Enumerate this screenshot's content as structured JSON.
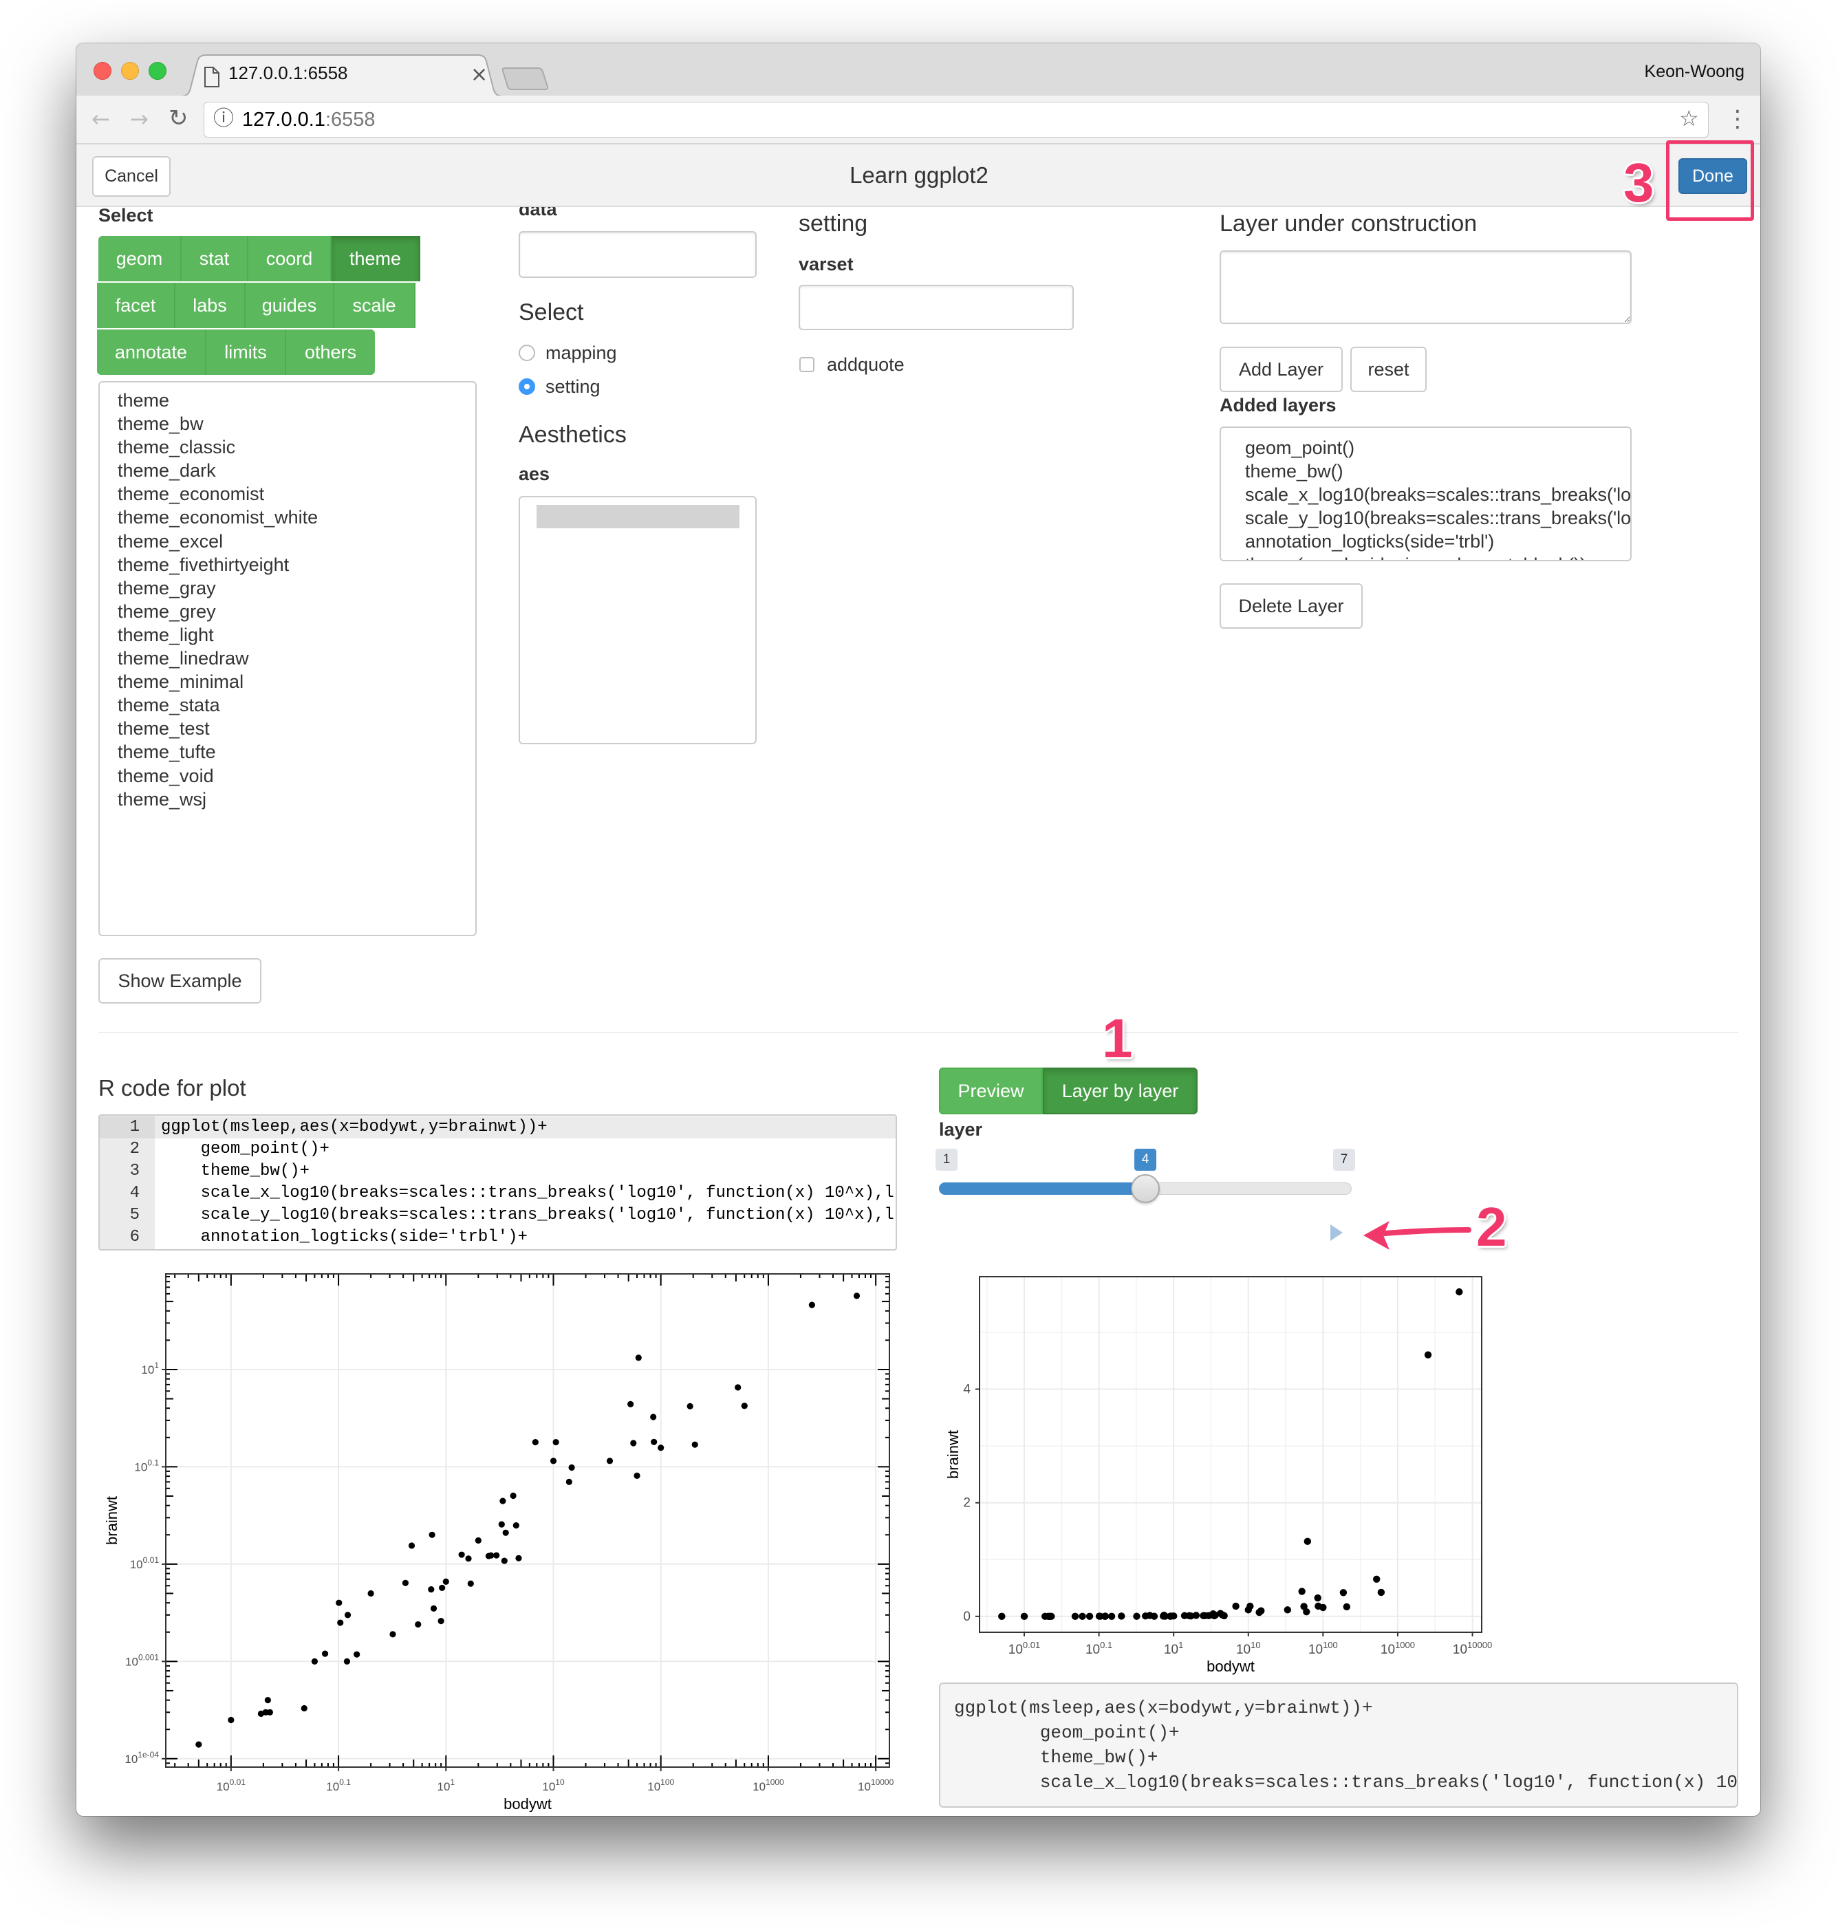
{
  "browser": {
    "tab_title": "127.0.0.1:6558",
    "profile_name": "Keon-Woong",
    "url_host": "127.0.0.1",
    "url_port": ":6558",
    "tab_close_glyph": "×"
  },
  "icons": {
    "back": "←",
    "forward": "→",
    "reload": "↻",
    "info": "ⓘ",
    "star": "☆",
    "menu": "⋮",
    "page": "file-icon",
    "play": "play-icon"
  },
  "header": {
    "cancel_label": "Cancel",
    "title": "Learn ggplot2",
    "done_label": "Done"
  },
  "left": {
    "select_label": "Select",
    "categories": [
      {
        "label": "geom",
        "active": false
      },
      {
        "label": "stat",
        "active": false
      },
      {
        "label": "coord",
        "active": false
      },
      {
        "label": "theme",
        "active": true
      },
      {
        "label": "facet",
        "active": false
      },
      {
        "label": "labs",
        "active": false
      },
      {
        "label": "guides",
        "active": false
      },
      {
        "label": "scale",
        "active": false
      },
      {
        "label": "annotate",
        "active": false
      },
      {
        "label": "limits",
        "active": false
      },
      {
        "label": "others",
        "active": false
      }
    ],
    "functions": [
      "theme",
      "theme_bw",
      "theme_classic",
      "theme_dark",
      "theme_economist",
      "theme_economist_white",
      "theme_excel",
      "theme_fivethirtyeight",
      "theme_gray",
      "theme_grey",
      "theme_light",
      "theme_linedraw",
      "theme_minimal",
      "theme_stata",
      "theme_test",
      "theme_tufte",
      "theme_void",
      "theme_wsj"
    ],
    "show_example_label": "Show Example"
  },
  "middle": {
    "data_label": "data",
    "data_value": "",
    "select_heading": "Select",
    "radios": [
      {
        "label": "mapping",
        "checked": false
      },
      {
        "label": "setting",
        "checked": true
      }
    ],
    "aesthetics_heading": "Aesthetics",
    "aes_label": "aes"
  },
  "setting": {
    "heading": "setting",
    "varset_label": "varset",
    "varset_value": "",
    "addquote_label": "addquote",
    "addquote_checked": false
  },
  "layer": {
    "heading": "Layer under construction",
    "textarea_value": "",
    "add_label": "Add Layer",
    "reset_label": "reset",
    "added_heading": "Added layers",
    "added": [
      "geom_point()",
      "theme_bw()",
      "scale_x_log10(breaks=scales::trans_breaks('lo",
      "scale_y_log10(breaks=scales::trans_breaks('lo",
      "annotation_logticks(side='trbl')",
      "theme(panel.grid.minor=element_blank())"
    ],
    "delete_label": "Delete Layer"
  },
  "rcode": {
    "heading": "R code for plot",
    "lines": [
      {
        "num": "1",
        "text": "ggplot(msleep,aes(x=bodywt,y=brainwt))+"
      },
      {
        "num": "2",
        "text": "    geom_point()+"
      },
      {
        "num": "3",
        "text": "    theme_bw()+"
      },
      {
        "num": "4",
        "text": "    scale_x_log10(breaks=scales::trans_breaks('log10', function(x) 10^x),l"
      },
      {
        "num": "5",
        "text": "    scale_y_log10(breaks=scales::trans_breaks('log10', function(x) 10^x),l"
      },
      {
        "num": "6",
        "text": "    annotation_logticks(side='trbl')+"
      }
    ]
  },
  "viewer": {
    "modes": [
      {
        "label": "Preview",
        "active": false
      },
      {
        "label": "Layer by layer",
        "active": true
      }
    ],
    "layer_label": "layer",
    "slider": {
      "min": 1,
      "max": 7,
      "value": 4,
      "min_label": "1",
      "max_label": "7",
      "value_label": "4"
    },
    "code_lines": [
      "ggplot(msleep,aes(x=bodywt,y=brainwt))+",
      "        geom_point()+",
      "        theme_bw()+",
      "        scale_x_log10(breaks=scales::trans_breaks('log10', function(x) 10"
    ]
  },
  "annotations": {
    "one": "1",
    "two": "2",
    "three": "3"
  },
  "colors": {
    "accent_green": "#5cb85c",
    "active_green": "#449d44",
    "primary_blue": "#337ab7",
    "slider_blue": "#428bca",
    "annotation_pink": "#f0386b"
  },
  "chart_data": [
    {
      "id": "left-plot",
      "type": "scatter",
      "title": "",
      "xlabel": "bodywt",
      "ylabel": "brainwt",
      "x_scale": "log10",
      "y_scale": "log10",
      "x_breaks": [
        0.01,
        0.1,
        1,
        10,
        100,
        1000,
        10000
      ],
      "x_tick_labels": [
        {
          "base": "10",
          "exp": "0.01"
        },
        {
          "base": "10",
          "exp": "0.1"
        },
        {
          "base": "10",
          "exp": "1"
        },
        {
          "base": "10",
          "exp": "10"
        },
        {
          "base": "10",
          "exp": "100"
        },
        {
          "base": "10",
          "exp": "1000"
        },
        {
          "base": "10",
          "exp": "10000"
        }
      ],
      "y_breaks": [
        0.0001,
        0.001,
        0.01,
        0.1,
        1
      ],
      "y_tick_labels": [
        {
          "base": "10",
          "exp": "1e-04"
        },
        {
          "base": "10",
          "exp": "0.001"
        },
        {
          "base": "10",
          "exp": "0.01"
        },
        {
          "base": "10",
          "exp": "0.1"
        },
        {
          "base": "10",
          "exp": "1"
        }
      ],
      "xlim": [
        0.00247,
        13400
      ],
      "ylim": [
        8.2e-05,
        9.6
      ],
      "grid": "major",
      "minor_grid": false,
      "logticks": "trbl",
      "x": [
        0.48,
        0.019,
        600,
        14,
        14.8,
        33.5,
        0.728,
        4.75,
        0.42,
        0.06,
        1,
        0.005,
        3.5,
        2.95,
        1.7,
        2547,
        0.023,
        521,
        187,
        0.77,
        10,
        3.3,
        0.2,
        85,
        2.625,
        62,
        6654,
        6.8,
        0.12,
        0.022,
        0.01,
        1.4,
        2.5,
        55.5,
        52.2,
        100,
        10.55,
        0.55,
        0.021,
        1.62,
        60,
        3.6,
        0.32,
        0.743,
        0.075,
        0.148,
        0.122,
        0.92,
        0.101,
        0.048,
        86.25,
        4.5,
        207.501,
        0.9,
        0.104,
        2,
        3.38,
        4.23
      ],
      "y": [
        0.0155,
        0.00029,
        0.423,
        0.07,
        0.0982,
        0.115,
        0.0055,
        0.0115,
        0.0064,
        0.001,
        0.0066,
        0.00014,
        0.0108,
        0.0123,
        0.0063,
        4.603,
        0.0003,
        0.655,
        0.419,
        0.0035,
        0.115,
        0.0256,
        0.005,
        0.325,
        0.01227,
        1.32,
        5.712,
        0.179,
        0.001,
        0.0004,
        0.00025,
        0.0125,
        0.0121,
        0.175,
        0.44,
        0.157,
        0.179,
        0.0024,
        0.0003,
        0.0114,
        0.081,
        0.021,
        0.0019,
        0.02,
        0.0012,
        0.00118,
        0.003,
        0.0057,
        0.004,
        0.00033,
        0.18,
        0.025,
        0.169,
        0.0026,
        0.0025,
        0.0175,
        0.0445,
        0.0504
      ]
    },
    {
      "id": "right-plot",
      "type": "scatter",
      "title": "",
      "xlabel": "bodywt",
      "ylabel": "brainwt",
      "x_scale": "log10",
      "y_scale": "linear",
      "x_breaks": [
        0.01,
        0.1,
        1,
        10,
        100,
        1000,
        10000
      ],
      "x_tick_labels": [
        {
          "base": "10",
          "exp": "0.01"
        },
        {
          "base": "10",
          "exp": "0.1"
        },
        {
          "base": "10",
          "exp": "1"
        },
        {
          "base": "10",
          "exp": "10"
        },
        {
          "base": "10",
          "exp": "100"
        },
        {
          "base": "10",
          "exp": "1000"
        },
        {
          "base": "10",
          "exp": "10000"
        }
      ],
      "y_breaks": [
        0,
        2,
        4
      ],
      "y_tick_labels": [
        {
          "base": "0",
          "exp": ""
        },
        {
          "base": "2",
          "exp": ""
        },
        {
          "base": "4",
          "exp": ""
        }
      ],
      "xlim": [
        0.00252,
        13300
      ],
      "ylim": [
        -0.28,
        5.98
      ],
      "grid": "major+minor",
      "minor_grid": true,
      "logticks": "",
      "x": [
        0.48,
        0.019,
        600,
        14,
        14.8,
        33.5,
        0.728,
        4.75,
        0.42,
        0.06,
        1,
        0.005,
        3.5,
        2.95,
        1.7,
        2547,
        0.023,
        521,
        187,
        0.77,
        10,
        3.3,
        0.2,
        85,
        2.625,
        62,
        6654,
        6.8,
        0.12,
        0.022,
        0.01,
        1.4,
        2.5,
        55.5,
        52.2,
        100,
        10.55,
        0.55,
        0.021,
        1.62,
        60,
        3.6,
        0.32,
        0.743,
        0.075,
        0.148,
        0.122,
        0.92,
        0.101,
        0.048,
        86.25,
        4.5,
        207.501,
        0.9,
        0.104,
        2,
        3.38,
        4.23
      ],
      "y": [
        0.0155,
        0.00029,
        0.423,
        0.07,
        0.0982,
        0.115,
        0.0055,
        0.0115,
        0.0064,
        0.001,
        0.0066,
        0.00014,
        0.0108,
        0.0123,
        0.0063,
        4.603,
        0.0003,
        0.655,
        0.419,
        0.0035,
        0.115,
        0.0256,
        0.005,
        0.325,
        0.01227,
        1.32,
        5.712,
        0.179,
        0.001,
        0.0004,
        0.00025,
        0.0125,
        0.0121,
        0.175,
        0.44,
        0.157,
        0.179,
        0.0024,
        0.0003,
        0.0114,
        0.081,
        0.021,
        0.0019,
        0.02,
        0.0012,
        0.00118,
        0.003,
        0.0057,
        0.004,
        0.00033,
        0.18,
        0.025,
        0.169,
        0.0026,
        0.0025,
        0.0175,
        0.0445,
        0.0504
      ]
    }
  ]
}
